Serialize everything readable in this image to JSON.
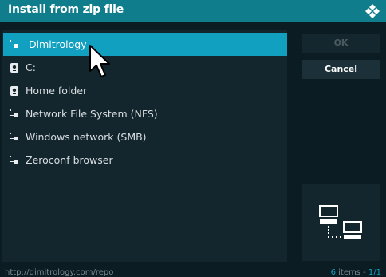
{
  "window": {
    "title": "Install from zip file"
  },
  "colors": {
    "header": "#0f7d8c",
    "selected": "#12a0c0",
    "background": "#0b1c23",
    "panel": "#13262e"
  },
  "list": {
    "items": [
      {
        "label": "Dimitrology",
        "icon": "network-share-icon",
        "selected": true
      },
      {
        "label": "C:",
        "icon": "drive-icon",
        "selected": false
      },
      {
        "label": "Home folder",
        "icon": "drive-icon",
        "selected": false
      },
      {
        "label": "Network File System (NFS)",
        "icon": "network-share-icon",
        "selected": false
      },
      {
        "label": "Windows network (SMB)",
        "icon": "network-share-icon",
        "selected": false
      },
      {
        "label": "Zeroconf browser",
        "icon": "network-share-icon",
        "selected": false
      }
    ]
  },
  "buttons": {
    "ok_label": "OK",
    "cancel_label": "Cancel"
  },
  "preview": {
    "icon": "network-computers-icon"
  },
  "footer": {
    "path": "http://dimitrology.com/repo",
    "count": "6",
    "items_text": "items - ",
    "page": "1/1"
  }
}
